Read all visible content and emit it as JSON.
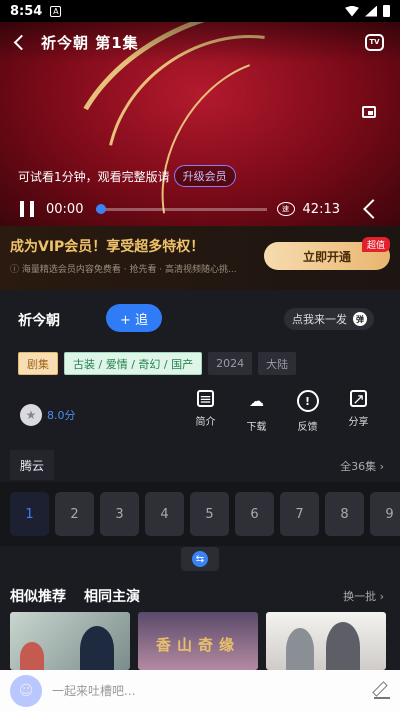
{
  "status_bar": {
    "time": "8:54",
    "notif": "A"
  },
  "player": {
    "title": "祈今朝   第1集",
    "tv_label": "TV",
    "trial_text": "可试看1分钟，观看完整版请",
    "trial_button": "升级会员",
    "current_time": "00:00",
    "total_time": "42:13",
    "speed_icon_text": "速",
    "progress": 0.0
  },
  "vip": {
    "title": "成为VIP会员！享受超多特权！",
    "subtitle": "ⓘ 海量精选会员内容免费看 · 抢先看 · 高清视频随心挑...",
    "button": "立即开通",
    "badge": "超值"
  },
  "show": {
    "name": "祈今朝",
    "follow": "+ 追",
    "danmu": "点我来一发",
    "danmu_icon": "弹",
    "tags": {
      "episode": "剧集",
      "genre": "古装 / 爱情 / 奇幻 / 国产",
      "year": "2024",
      "region": "大陆"
    },
    "rating": "8.0分",
    "actions": [
      {
        "label": "简介",
        "icon": "doc-icon"
      },
      {
        "label": "下载",
        "icon": "download-icon"
      },
      {
        "label": "反馈",
        "icon": "feedback-icon"
      },
      {
        "label": "分享",
        "icon": "share-icon"
      }
    ]
  },
  "episodes": {
    "source": "腾云",
    "total": "全36集 ›",
    "list": [
      "1",
      "2",
      "3",
      "4",
      "5",
      "6",
      "7",
      "8",
      "9"
    ]
  },
  "recommend": {
    "tab_similar": "相似推荐",
    "tab_cast": "相同主演",
    "more": "换一批 ›",
    "thumb2_text": "香山奇缘"
  },
  "comment": {
    "placeholder": "一起来吐槽吧..."
  }
}
